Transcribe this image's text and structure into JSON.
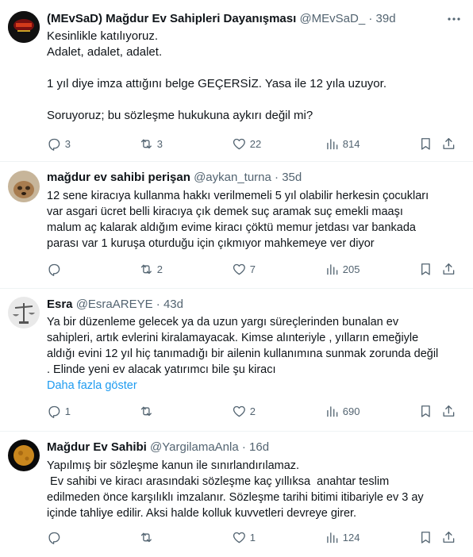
{
  "tweets": [
    {
      "name": "(MEvSaD) Mağdur Ev Sahipleri Dayanışması",
      "handle": "@MEvSaD_",
      "sep": "·",
      "time": "39d",
      "lines": [
        "Kesinlikle katılıyoruz.",
        "Adalet, adalet, adalet.",
        "",
        "1 yıl diye imza attığını belge GEÇERSİZ. Yasa ile 12 yıla uzuyor.",
        "",
        "Soruyoruz; bu sözleşme hukukuna aykırı değil mi?"
      ],
      "show_more": "",
      "replies": "3",
      "retweets": "3",
      "likes": "22",
      "views": "814"
    },
    {
      "name": "mağdur ev sahibi perişan",
      "handle": "@aykan_turna",
      "sep": "·",
      "time": "35d",
      "lines": [
        "12 sene kiracıya kullanma hakkı verilmemeli 5 yıl olabilir herkesin çocukları",
        "var asgari ücret belli kiracıya çık demek suç aramak suç emekli maaşı",
        "malum aç kalarak aldığım evime kiracı çöktü memur jetdası var bankada",
        "parası var 1 kuruşa oturduğu için çıkmıyor mahkemeye ver diyor"
      ],
      "show_more": "",
      "replies": "",
      "retweets": "2",
      "likes": "7",
      "views": "205"
    },
    {
      "name": "Esra",
      "handle": "@EsraAREYE",
      "sep": "·",
      "time": "43d",
      "lines": [
        "Ya bir düzenleme gelecek ya da uzun yargı süreçlerinden bunalan ev",
        "sahipleri, artık evlerini kiralamayacak. Kimse alınteriyle , yılların emeğiyle",
        "aldığı evini 12 yıl hiç tanımadığı bir ailenin kullanımına sunmak zorunda değil",
        ". Elinde yeni ev alacak yatırımcı bile şu kiracı"
      ],
      "show_more": "Daha fazla göster",
      "replies": "1",
      "retweets": "",
      "likes": "2",
      "views": "690"
    },
    {
      "name": "Mağdur Ev Sahibi",
      "handle": "@YargilamaAnla",
      "sep": "·",
      "time": "16d",
      "lines": [
        "Yapılmış bir sözleşme kanun ile sınırlandırılamaz.",
        " Ev sahibi ve kiracı arasındaki sözleşme kaç yıllıksa  anahtar teslim",
        "edilmeden önce karşılıklı imzalanır. Sözleşme tarihi bitimi itibariyle ev 3 ay",
        "içinde tahliye edilir. Aksi halde kolluk kuvvetleri devreye girer."
      ],
      "show_more": "",
      "replies": "",
      "retweets": "",
      "likes": "1",
      "views": "124"
    }
  ],
  "icons": {
    "reply": "reply-icon",
    "retweet": "retweet-icon",
    "like": "heart-icon",
    "views": "views-icon",
    "bookmark": "bookmark-icon",
    "share": "share-icon",
    "more": "more-icon"
  },
  "colors": {
    "link": "#1d9bf0",
    "secondary_text": "#536471",
    "divider": "#eff3f4"
  }
}
